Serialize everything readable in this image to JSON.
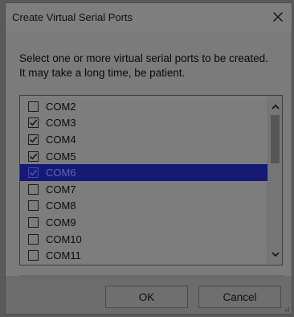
{
  "dialog": {
    "title": "Create Virtual Serial Ports",
    "close_icon": "close-icon"
  },
  "message": {
    "line1": "Select one or more virtual serial ports to be created.",
    "line2": "It may take a long time, be patient."
  },
  "ports": {
    "items": [
      {
        "label": "COM2",
        "checked": false,
        "selected": false
      },
      {
        "label": "COM3",
        "checked": true,
        "selected": false
      },
      {
        "label": "COM4",
        "checked": true,
        "selected": false
      },
      {
        "label": "COM5",
        "checked": true,
        "selected": false
      },
      {
        "label": "COM6",
        "checked": true,
        "selected": true
      },
      {
        "label": "COM7",
        "checked": false,
        "selected": false
      },
      {
        "label": "COM8",
        "checked": false,
        "selected": false
      },
      {
        "label": "COM9",
        "checked": false,
        "selected": false
      },
      {
        "label": "COM10",
        "checked": false,
        "selected": false
      },
      {
        "label": "COM11",
        "checked": false,
        "selected": false
      }
    ]
  },
  "buttons": {
    "ok_label": "OK",
    "cancel_label": "Cancel"
  },
  "colors": {
    "selection": "#161a75",
    "background": "#7b7b7b"
  }
}
